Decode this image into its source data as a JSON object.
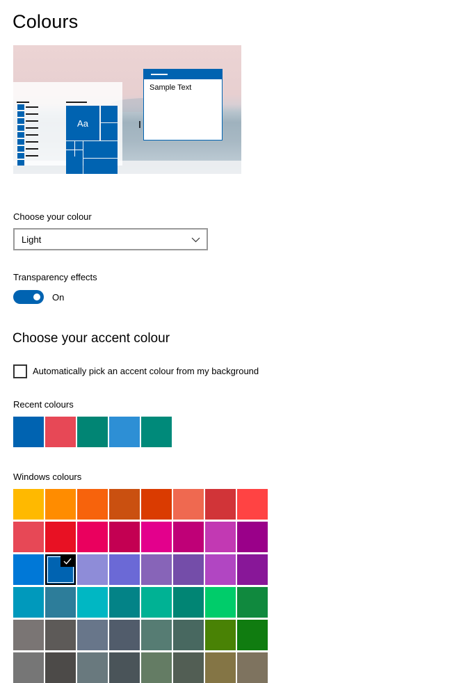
{
  "page": {
    "title": "Colours"
  },
  "preview": {
    "sample_text": "Sample Text",
    "tile_text": "Aa"
  },
  "colour_mode": {
    "label": "Choose your colour",
    "value": "Light"
  },
  "transparency": {
    "label": "Transparency effects",
    "state": "On",
    "enabled": true
  },
  "accent": {
    "heading": "Choose your accent colour",
    "auto_pick_label": "Automatically pick an accent colour from my background",
    "auto_pick_checked": false
  },
  "recent": {
    "label": "Recent colours",
    "colours": [
      "#0063b1",
      "#e74856",
      "#018574",
      "#2d8fd5",
      "#008a7a"
    ]
  },
  "windows": {
    "label": "Windows colours",
    "selected_index": 17,
    "colours": [
      "#ffb900",
      "#ff8c00",
      "#f7630c",
      "#ca5010",
      "#da3b01",
      "#ef6950",
      "#d13438",
      "#ff4343",
      "#e74856",
      "#e81123",
      "#ea005e",
      "#c30052",
      "#e3008c",
      "#bf0077",
      "#c239b3",
      "#9a0089",
      "#0078d7",
      "#0063b1",
      "#8e8cd8",
      "#6b69d6",
      "#8764b8",
      "#744da9",
      "#b146c2",
      "#881798",
      "#0099bc",
      "#2d7d9a",
      "#00b7c3",
      "#038387",
      "#00b294",
      "#018574",
      "#00cc6a",
      "#10893e",
      "#7a7574",
      "#5d5a58",
      "#68768a",
      "#515c6b",
      "#567c73",
      "#486860",
      "#498205",
      "#107c10",
      "#767676",
      "#4c4a48",
      "#69797e",
      "#4a5459",
      "#647c64",
      "#525e54",
      "#847545",
      "#7e735f"
    ]
  }
}
